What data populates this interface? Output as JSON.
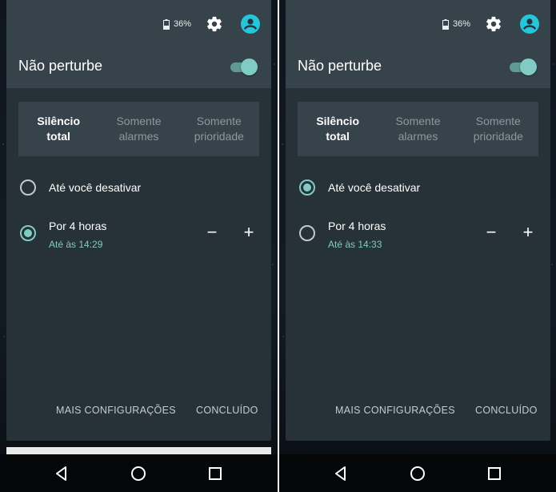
{
  "status": {
    "battery": "36%"
  },
  "header": {
    "title": "Não perturbe"
  },
  "modes": [
    {
      "label": "Silêncio\ntotal"
    },
    {
      "label": "Somente\nalarmes"
    },
    {
      "label": "Somente\nprioridade"
    }
  ],
  "option_until_off": {
    "label": "Até você desativar"
  },
  "option_hours": {
    "label": "Por 4 horas",
    "minus": "−",
    "plus": "+"
  },
  "left": {
    "hours_sub": "Até às 14:29"
  },
  "right": {
    "hours_sub": "Até às 14:33"
  },
  "actions": {
    "more_settings": "MAIS CONFIGURAÇÕES",
    "done": "CONCLUÍDO"
  },
  "colors": {
    "accent": "#80cbc4",
    "panel": "#263238",
    "header": "#36434a"
  },
  "icons": [
    "battery-icon",
    "gear-icon",
    "account-circle-icon",
    "back-icon",
    "home-icon",
    "recents-icon"
  ]
}
